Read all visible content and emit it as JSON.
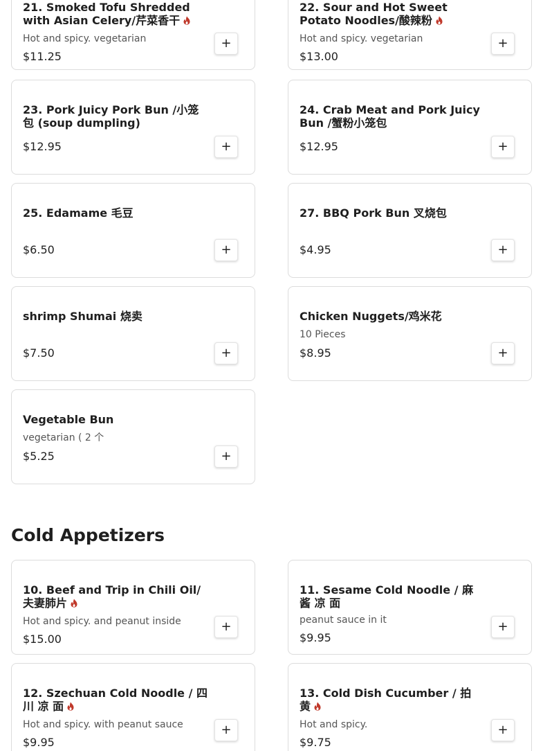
{
  "colors": {
    "spicy": "#c0392b",
    "card_border": "#dcdcdc"
  },
  "items_top": [
    {
      "name": "21. Smoked Tofu Shredded with Asian Celery/芹菜香干",
      "spicy": true,
      "description": "Hot and spicy. vegetarian",
      "price": "$11.25"
    },
    {
      "name": "22. Sour and Hot Sweet Potato Noodles/酸辣粉",
      "spicy": true,
      "description": "Hot and spicy. vegetarian",
      "price": "$13.00"
    },
    {
      "name": "23. Pork Juicy Pork Bun /小笼包 (soup dumpling)",
      "spicy": false,
      "description": "",
      "price": "$12.95"
    },
    {
      "name": "24. Crab Meat and Pork Juicy Bun /蟹粉小笼包",
      "spicy": false,
      "description": "",
      "price": "$12.95"
    },
    {
      "name": "25. Edamame 毛豆",
      "spicy": false,
      "description": "",
      "price": "$6.50"
    },
    {
      "name": "27. BBQ Pork Bun 叉烧包",
      "spicy": false,
      "description": "",
      "price": "$4.95"
    },
    {
      "name": "shrimp Shumai 烧卖",
      "spicy": false,
      "description": "",
      "price": "$7.50"
    },
    {
      "name": "Chicken Nuggets/鸡米花",
      "spicy": false,
      "description": "10 Pieces",
      "price": "$8.95"
    },
    {
      "name": "Vegetable Bun",
      "spicy": false,
      "description": "vegetarian ( 2 个",
      "price": "$5.25"
    }
  ],
  "section": {
    "title": "Cold Appetizers"
  },
  "items_cold": [
    {
      "name": "10. Beef and Trip in Chili Oil/夫妻肺片",
      "spicy": true,
      "description": "Hot and spicy. and peanut inside",
      "price": "$15.00"
    },
    {
      "name": "11. Sesame Cold Noodle / 麻 酱 凉 面",
      "spicy": false,
      "description": "peanut sauce in it",
      "price": "$9.95"
    },
    {
      "name": "12. Szechuan Cold Noodle / 四 川 凉 面",
      "spicy": true,
      "description": "Hot and spicy. with peanut sauce",
      "price": "$9.95"
    },
    {
      "name": "13. Cold Dish Cucumber / 拍 黄",
      "spicy": true,
      "description": "Hot and spicy.",
      "price": "$9.75"
    }
  ],
  "add_button_label": "+",
  "icons": {
    "spicy": "flame-icon",
    "add": "plus-icon"
  }
}
